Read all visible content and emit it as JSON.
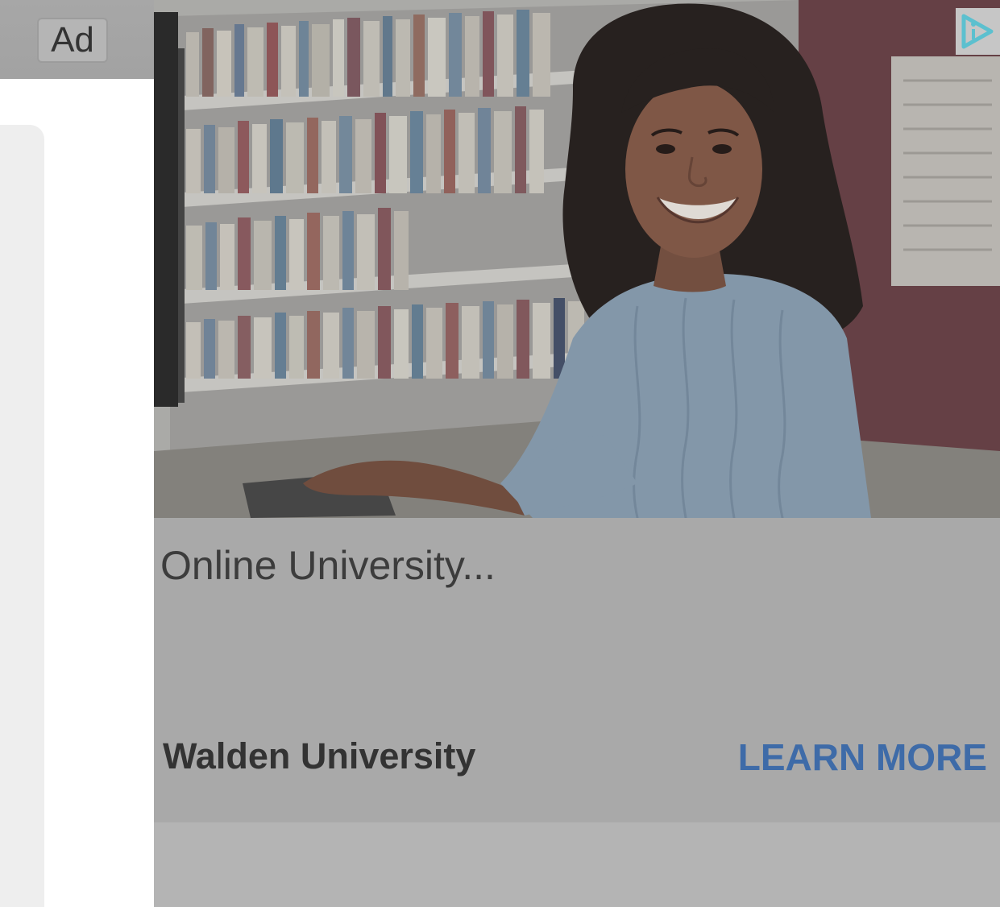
{
  "badge": {
    "label": "Ad"
  },
  "ad": {
    "headline": "Online University...",
    "advertiser": "Walden University",
    "cta_label": "LEARN MORE",
    "cta_color": "#3e6ba8",
    "image_description_icon": "woman-at-library-computer-photo"
  },
  "icons": {
    "adchoices": "adchoices-icon"
  }
}
